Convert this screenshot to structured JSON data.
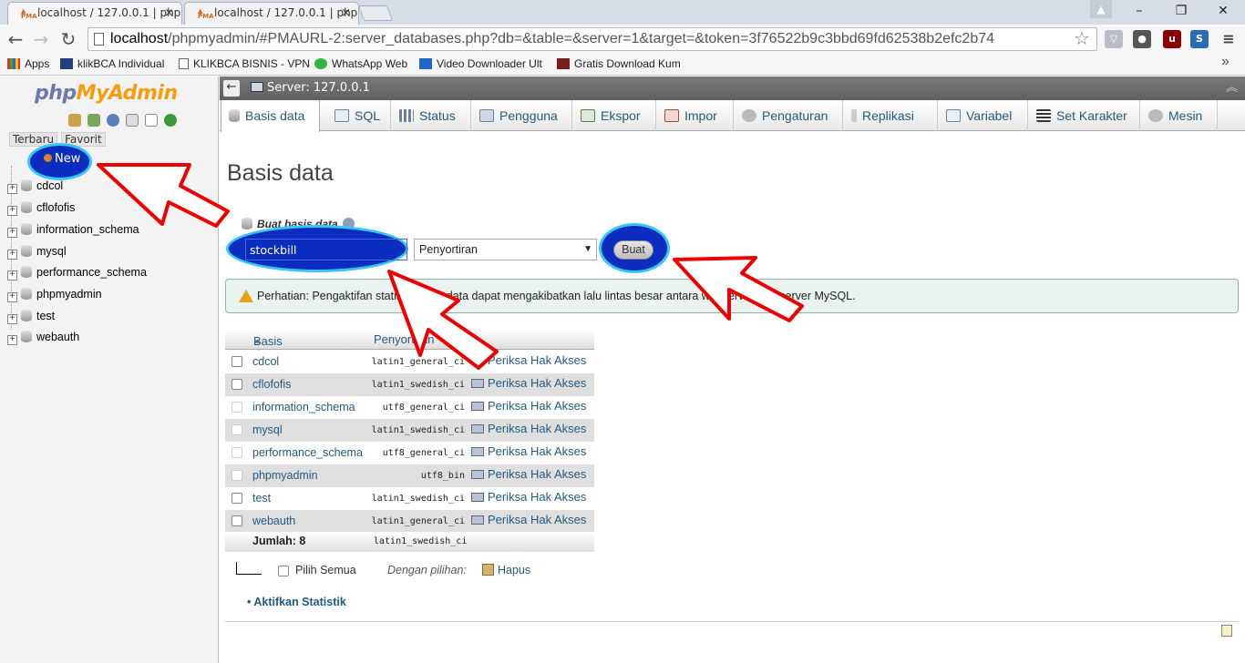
{
  "browser": {
    "tabs": [
      {
        "title": "localhost / 127.0.0.1 | php"
      },
      {
        "title": "localhost / 127.0.0.1 | php"
      }
    ],
    "address_host": "localhost",
    "address_rest": "/phpmyadmin/#PMAURL-2:server_databases.php?db=&table=&server=1&target=&token=3f76522b9c3bbd69fd62538b2efc2b74",
    "bookmarks": [
      {
        "label": "Apps"
      },
      {
        "label": "klikBCA Individual"
      },
      {
        "label": "KLIKBCA BISNIS - VPN"
      },
      {
        "label": "WhatsApp Web"
      },
      {
        "label": "Video Downloader Ult"
      },
      {
        "label": "Gratis Download Kum"
      }
    ]
  },
  "left": {
    "logo_php": "php",
    "logo_my": "My",
    "logo_admin": "Admin",
    "recent": "Terbaru",
    "favorite": "Favorit",
    "new_label": "New",
    "databases": [
      "cdcol",
      "cflofofis",
      "information_schema",
      "mysql",
      "performance_schema",
      "phpmyadmin",
      "test",
      "webauth"
    ]
  },
  "main": {
    "server_label": "Server: 127.0.0.1",
    "tabs": [
      {
        "label": "Basis data"
      },
      {
        "label": "SQL"
      },
      {
        "label": "Status"
      },
      {
        "label": "Pengguna"
      },
      {
        "label": "Ekspor"
      },
      {
        "label": "Impor"
      },
      {
        "label": "Pengaturan"
      },
      {
        "label": "Replikasi"
      },
      {
        "label": "Variabel"
      },
      {
        "label": "Set Karakter"
      },
      {
        "label": "Mesin"
      }
    ],
    "page_title": "Basis data",
    "create_label": "Buat basis data",
    "new_db_value": "stockbill",
    "collation_value": "Penyortiran",
    "create_button": "Buat",
    "notice": "Perhatian: Pengaktifan statistik basis data dapat mengakibatkan lalu lintas besar antara webserver dan server MySQL.",
    "table": {
      "col_db": "Basis data",
      "col_collation": "Penyortiran",
      "privileges_label": "Periksa Hak Akses",
      "rows": [
        {
          "name": "cdcol",
          "collation": "latin1_general_ci"
        },
        {
          "name": "cflofofis",
          "collation": "latin1_swedish_ci"
        },
        {
          "name": "information_schema",
          "collation": "utf8_general_ci"
        },
        {
          "name": "mysql",
          "collation": "latin1_swedish_ci"
        },
        {
          "name": "performance_schema",
          "collation": "utf8_general_ci"
        },
        {
          "name": "phpmyadmin",
          "collation": "utf8_bin"
        },
        {
          "name": "test",
          "collation": "latin1_swedish_ci"
        },
        {
          "name": "webauth",
          "collation": "latin1_general_ci"
        }
      ],
      "total_label": "Jumlah: 8",
      "total_collation": "latin1_swedish_ci"
    },
    "select_all": "Pilih Semua",
    "with_selected": "Dengan pilihan:",
    "delete": "Hapus",
    "enable_stats": "Aktifkan Statistik"
  }
}
